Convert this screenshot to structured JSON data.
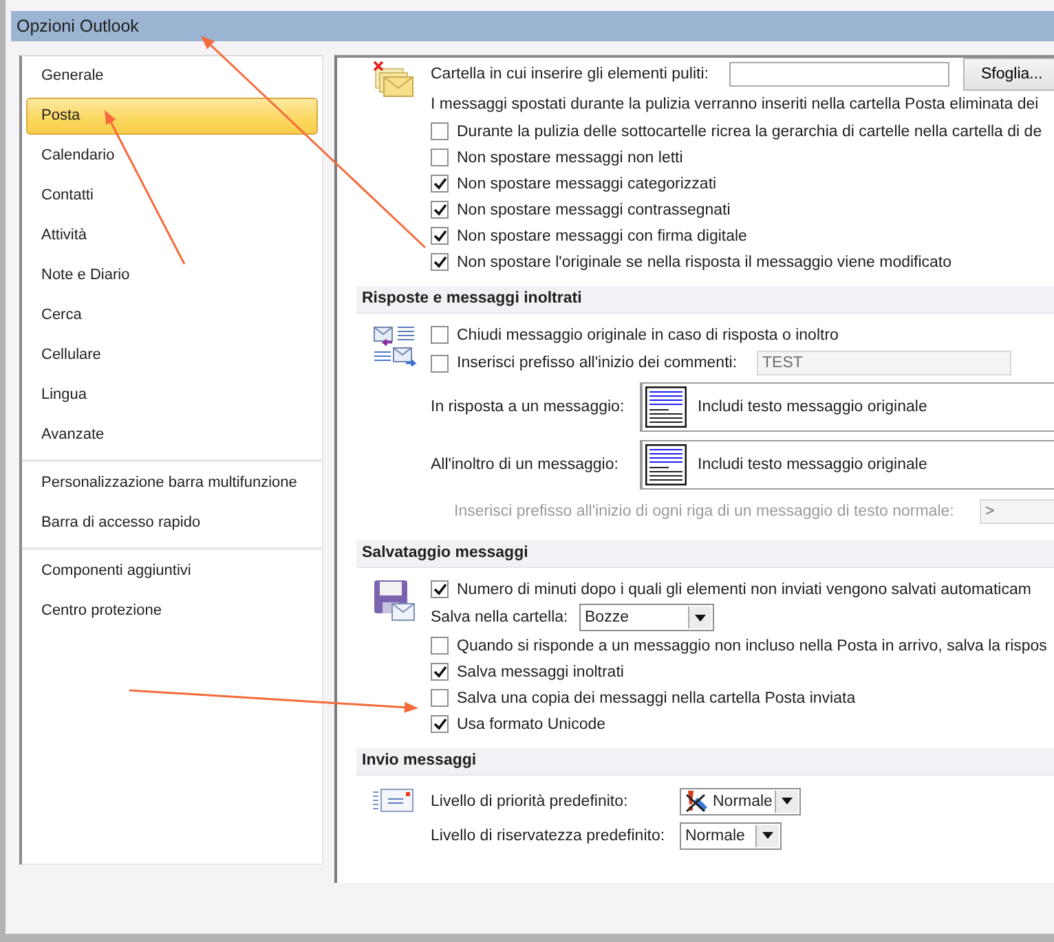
{
  "window": {
    "title": "Opzioni Outlook"
  },
  "sidebar": {
    "groups": [
      [
        {
          "label": "Generale",
          "selected": false
        },
        {
          "label": "Posta",
          "selected": true
        },
        {
          "label": "Calendario",
          "selected": false
        },
        {
          "label": "Contatti",
          "selected": false
        },
        {
          "label": "Attività",
          "selected": false
        },
        {
          "label": "Note e Diario",
          "selected": false
        },
        {
          "label": "Cerca",
          "selected": false
        },
        {
          "label": "Cellulare",
          "selected": false
        },
        {
          "label": "Lingua",
          "selected": false
        },
        {
          "label": "Avanzate",
          "selected": false
        }
      ],
      [
        {
          "label": "Personalizzazione barra multifunzione",
          "selected": false
        },
        {
          "label": "Barra di accesso rapido",
          "selected": false
        }
      ],
      [
        {
          "label": "Componenti aggiuntivi",
          "selected": false
        },
        {
          "label": "Centro protezione",
          "selected": false
        }
      ]
    ]
  },
  "sections": [
    {
      "rows": [
        {
          "kind": "folder",
          "label": "Cartella in cui inserire gli elementi puliti:",
          "button": "Sfoglia..."
        },
        {
          "kind": "note",
          "label": "I messaggi spostati durante la pulizia verranno inseriti nella cartella Posta eliminata dei"
        },
        {
          "kind": "checkbox",
          "label": "Durante la pulizia delle sottocartelle ricrea la gerarchia di cartelle nella cartella di de",
          "checked": false
        },
        {
          "kind": "checkbox",
          "label": "Non spostare messaggi non letti",
          "checked": false
        },
        {
          "kind": "checkbox",
          "label": "Non spostare messaggi categorizzati",
          "checked": true
        },
        {
          "kind": "checkbox",
          "label": "Non spostare messaggi contrassegnati",
          "checked": true
        },
        {
          "kind": "checkbox",
          "label": "Non spostare messaggi con firma digitale",
          "checked": true
        },
        {
          "kind": "checkbox",
          "label": "Non spostare l'originale se nella risposta il messaggio viene modificato",
          "checked": true
        }
      ]
    },
    {
      "title": "Risposte e messaggi inoltrati",
      "rows": [
        {
          "kind": "checkbox",
          "label": "Chiudi messaggio originale in caso di risposta o inoltro",
          "checked": false
        },
        {
          "kind": "checkbox_field",
          "label": "Inserisci prefisso all'inizio dei commenti:",
          "checked": false,
          "value": "TEST",
          "disabled": true
        },
        {
          "kind": "option",
          "label": "In risposta a un messaggio:",
          "value": "Includi testo messaggio originale"
        },
        {
          "kind": "option",
          "label": "All'inoltro di un messaggio:",
          "value": "Includi testo messaggio originale"
        },
        {
          "kind": "prefix",
          "label": "Inserisci prefisso all'inizio di ogni riga di un messaggio di testo normale:",
          "value": ">",
          "disabled": true
        }
      ]
    },
    {
      "title": "Salvataggio messaggi",
      "rows": [
        {
          "kind": "checkbox",
          "label": "Numero di minuti dopo i quali gli elementi non inviati vengono salvati automaticam",
          "checked": true
        },
        {
          "kind": "dropdown",
          "label": "Salva nella cartella:",
          "value": "Bozze"
        },
        {
          "kind": "checkbox",
          "label": "Quando si risponde a un messaggio non incluso nella Posta in arrivo, salva la rispos",
          "checked": false
        },
        {
          "kind": "checkbox",
          "label": "Salva messaggi inoltrati",
          "checked": true
        },
        {
          "kind": "checkbox",
          "label": "Salva una copia dei messaggi nella cartella Posta inviata",
          "checked": false
        },
        {
          "kind": "checkbox",
          "label": "Usa formato Unicode",
          "checked": true
        }
      ]
    },
    {
      "title": "Invio messaggi",
      "rows": [
        {
          "kind": "priority_dropdown",
          "label": "Livello di priorità predefinito:",
          "value": "Normale"
        },
        {
          "kind": "dropdown",
          "label": "Livello di riservatezza predefinito:",
          "value": "Normale"
        }
      ]
    }
  ]
}
